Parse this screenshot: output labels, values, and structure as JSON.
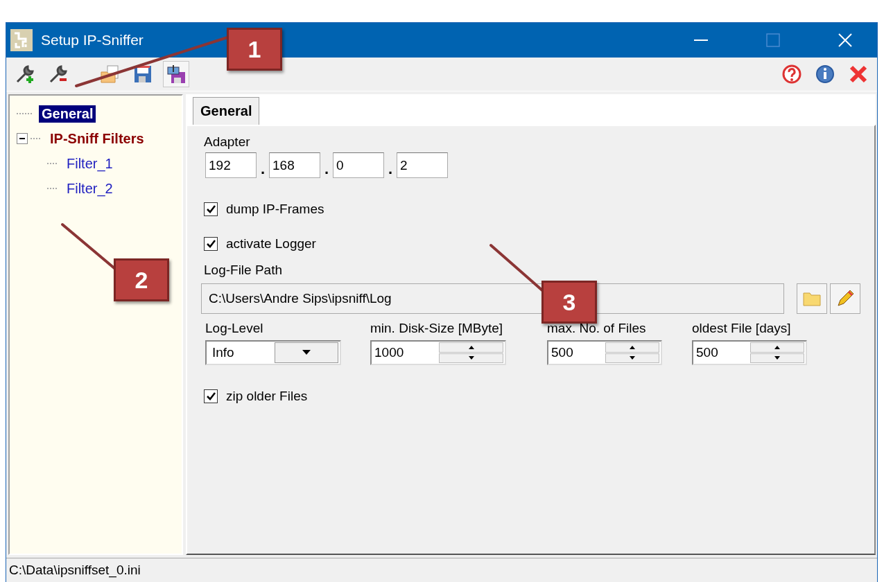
{
  "window": {
    "title": "Setup IP-Sniffer"
  },
  "tree": {
    "items": [
      {
        "label": "General",
        "kind": "page",
        "selected": true
      },
      {
        "label": "IP-Sniff Filters",
        "kind": "group",
        "selected": false,
        "expanded": true,
        "children": [
          {
            "label": "Filter_1",
            "kind": "filter",
            "selected": false
          },
          {
            "label": "Filter_2",
            "kind": "filter",
            "selected": false
          }
        ]
      }
    ]
  },
  "tabs": [
    {
      "label": "General",
      "selected": true
    }
  ],
  "adapter": {
    "label": "Adapter",
    "octets": [
      "192",
      "168",
      "0",
      "2"
    ],
    "separators": [
      ".",
      ".",
      "."
    ]
  },
  "dump_ip_frames": {
    "label": "dump IP-Frames",
    "checked": true
  },
  "activate_logger": {
    "label": "activate Logger",
    "checked": true
  },
  "log_file_path": {
    "label": "Log-File Path",
    "value": "C:\\Users\\Andre Sips\\ipsniff\\Log"
  },
  "log_level": {
    "label": "Log-Level",
    "value": "Info"
  },
  "spinners": [
    {
      "label": "min. Disk-Size [MByte]",
      "value": "1000"
    },
    {
      "label": "max. No. of Files",
      "value": "500"
    },
    {
      "label": "oldest File [days]",
      "value": "500"
    }
  ],
  "zip_older_files": {
    "label": "zip older Files",
    "checked": true
  },
  "status_bar": {
    "text": "C:\\Data\\ipsniffset_0.ini"
  },
  "callouts": [
    {
      "label": "1"
    },
    {
      "label": "2"
    },
    {
      "label": "3"
    }
  ]
}
